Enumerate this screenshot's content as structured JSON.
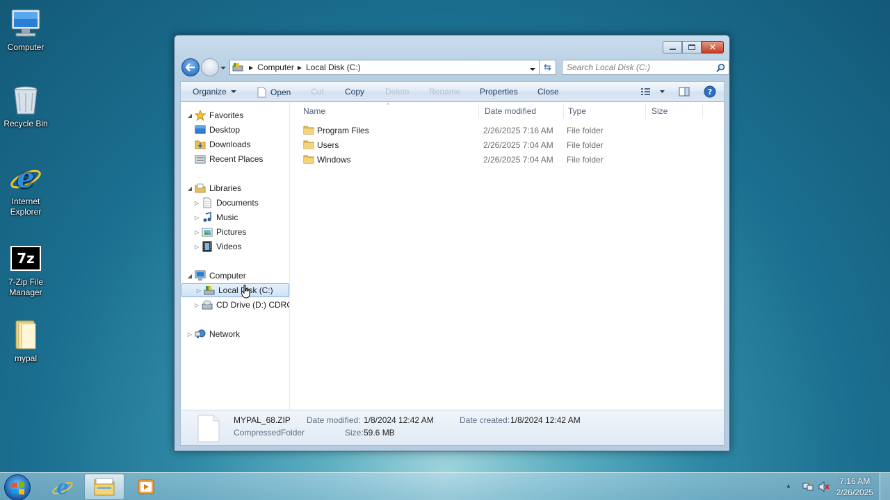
{
  "desktop": {
    "icons": [
      {
        "label": "Computer"
      },
      {
        "label": "Recycle Bin"
      },
      {
        "label": "Internet Explorer"
      },
      {
        "label": "7-Zip File Manager"
      },
      {
        "label": "mypal"
      }
    ],
    "seven_zip_glyph": "7z"
  },
  "window": {
    "address": {
      "crumbs": [
        "Computer",
        "Local Disk (C:)"
      ]
    },
    "search_placeholder": "Search Local Disk (C:)",
    "toolbar": {
      "organize": "Organize",
      "open": "Open",
      "cut": "Cut",
      "copy": "Copy",
      "delete": "Delete",
      "rename": "Rename",
      "properties": "Properties",
      "close": "Close"
    },
    "nav": {
      "favorites": "Favorites",
      "desktop": "Desktop",
      "downloads": "Downloads",
      "recent_places": "Recent Places",
      "libraries": "Libraries",
      "documents": "Documents",
      "music": "Music",
      "pictures": "Pictures",
      "videos": "Videos",
      "computer": "Computer",
      "local_disk": "Local Disk (C:)",
      "cd_drive": "CD Drive (D:) CDROM",
      "network": "Network"
    },
    "columns": {
      "name": "Name",
      "date_modified": "Date modified",
      "type": "Type",
      "size": "Size"
    },
    "files": [
      {
        "name": "Program Files",
        "date": "2/26/2025 7:16 AM",
        "type": "File folder"
      },
      {
        "name": "Users",
        "date": "2/26/2025 7:04 AM",
        "type": "File folder"
      },
      {
        "name": "Windows",
        "date": "2/26/2025 7:04 AM",
        "type": "File folder"
      }
    ],
    "details": {
      "filename": "MYPAL_68.ZIP",
      "filetype": "CompressedFolder",
      "date_modified_label": "Date modified:",
      "date_modified": "1/8/2024 12:42 AM",
      "date_created_label": "Date created:",
      "date_created": "1/8/2024 12:42 AM",
      "size_label": "Size:",
      "size": "59.6 MB"
    }
  },
  "taskbar": {
    "time": "7:16 AM",
    "date": "2/26/2025"
  },
  "colors": {
    "desktop_bg": "#1b6f90",
    "folder": "#e8c25a",
    "selection": "#cce4f7",
    "toolbar_text": "#1e395b"
  }
}
